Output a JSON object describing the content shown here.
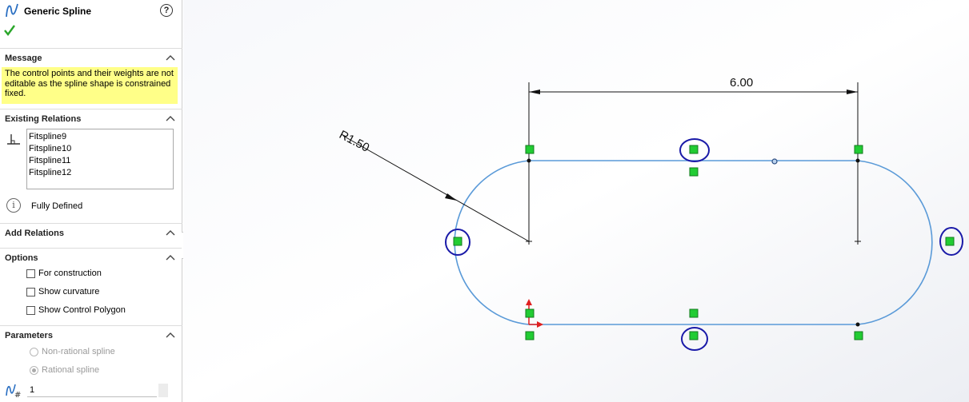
{
  "panel": {
    "title": "Generic Spline",
    "help": "?",
    "message": {
      "header": "Message",
      "text": "The control points and their weights are not editable as the spline shape is constrained fixed."
    },
    "existing_relations": {
      "header": "Existing Relations",
      "items": [
        "Fitspline9",
        "Fitspline10",
        "Fitspline11",
        "Fitspline12"
      ],
      "status": "Fully Defined"
    },
    "add_relations": {
      "header": "Add Relations"
    },
    "options": {
      "header": "Options",
      "items": [
        {
          "label": "For construction",
          "checked": false
        },
        {
          "label": "Show curvature",
          "checked": false
        },
        {
          "label": "Show Control Polygon",
          "checked": false
        }
      ]
    },
    "parameters": {
      "header": "Parameters",
      "radios": [
        {
          "label": "Non-rational spline",
          "selected": false,
          "enabled": false
        },
        {
          "label": "Rational spline",
          "selected": true,
          "enabled": false
        }
      ],
      "weight_value": "1"
    }
  },
  "sketch": {
    "width_dimension": "6.00",
    "radius_dimension": "R1.50"
  },
  "colors": {
    "spline": "#5a9ad8",
    "relation_marker": "#22cc33",
    "highlight_circle": "#1a1aa8",
    "message_bg": "#ffff88",
    "check": "#2aa62a"
  },
  "icons": {
    "title": "spline-icon",
    "ok": "checkmark-icon",
    "relations": "perpendicular-icon",
    "status": "info-icon",
    "weight": "weight-icon"
  }
}
